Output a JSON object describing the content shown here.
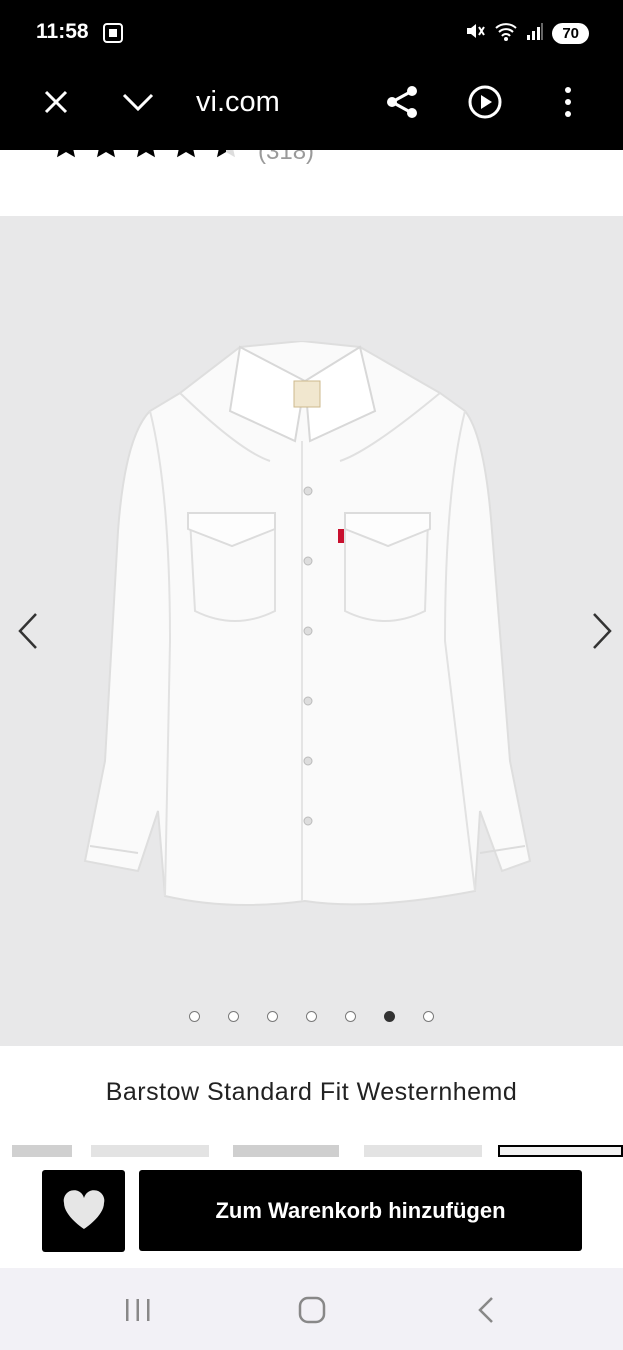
{
  "status_bar": {
    "time": "11:58",
    "battery": "70"
  },
  "browser": {
    "url": "vi.com"
  },
  "product": {
    "rating_count": "(318)",
    "title": "Barstow Standard Fit Westernhemd",
    "image_count": 7,
    "active_image": 6,
    "rating_stars": 4.5
  },
  "actions": {
    "cart_label": "Zum Warenkorb hinzufügen"
  },
  "colors": {
    "accent": "#000000",
    "gallery_bg": "#e8e8e9"
  }
}
